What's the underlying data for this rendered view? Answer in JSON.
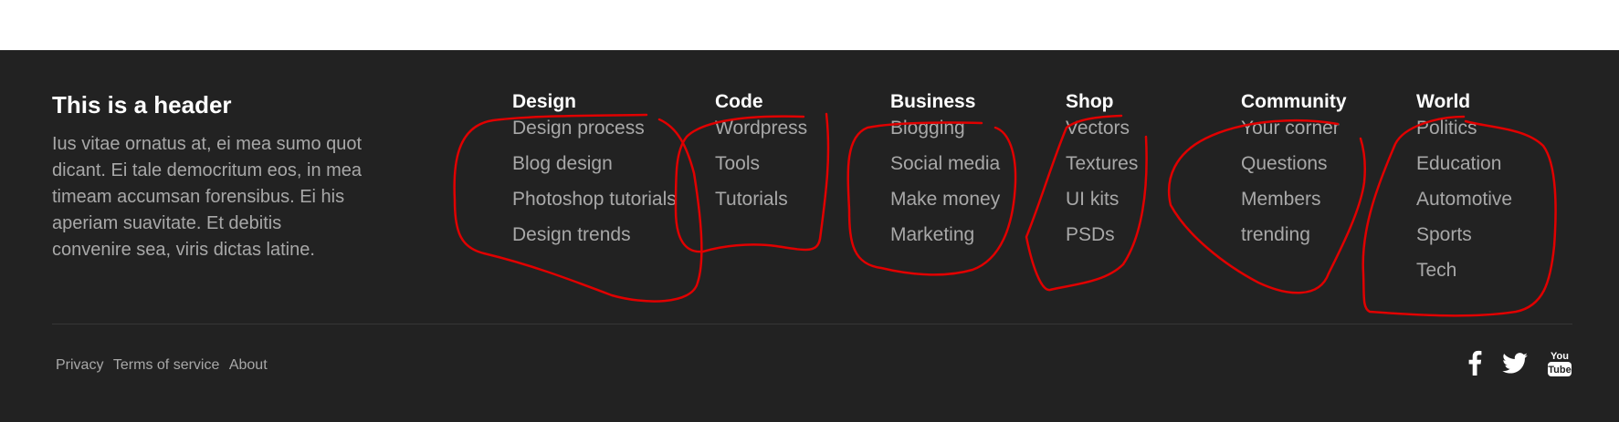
{
  "brand": {
    "title": "This is a header",
    "text": "Ius vitae ornatus at, ei mea sumo quot dicant. Ei tale democritum eos, in mea timeam accumsan forensibus. Ei his aperiam suavitate. Et debitis convenire sea, viris dictas latine."
  },
  "columns": [
    {
      "title": "Design",
      "links": [
        "Design process",
        "Blog design",
        "Photoshop tutorials",
        "Design trends"
      ]
    },
    {
      "title": "Code",
      "links": [
        "Wordpress",
        "Tools",
        "Tutorials"
      ]
    },
    {
      "title": "Business",
      "links": [
        "Blogging",
        "Social media",
        "Make money",
        "Marketing"
      ]
    },
    {
      "title": "Shop",
      "links": [
        "Vectors",
        "Textures",
        "UI kits",
        "PSDs"
      ]
    },
    {
      "title": "Community",
      "links": [
        "Your corner",
        "Questions",
        "Members",
        "trending"
      ]
    },
    {
      "title": "World",
      "links": [
        "Politics",
        "Education",
        "Automotive",
        "Sports",
        "Tech"
      ]
    }
  ],
  "legal": [
    "Privacy",
    "Terms of service",
    "About"
  ],
  "social": [
    "facebook-icon",
    "twitter-icon",
    "youtube-icon"
  ],
  "youtube_logo": {
    "top": "You",
    "bottom": "Tube"
  },
  "colors": {
    "footer_bg": "#222222",
    "heading": "#ffffff",
    "link": "#a8a8a8",
    "annotation": "#e00000"
  }
}
